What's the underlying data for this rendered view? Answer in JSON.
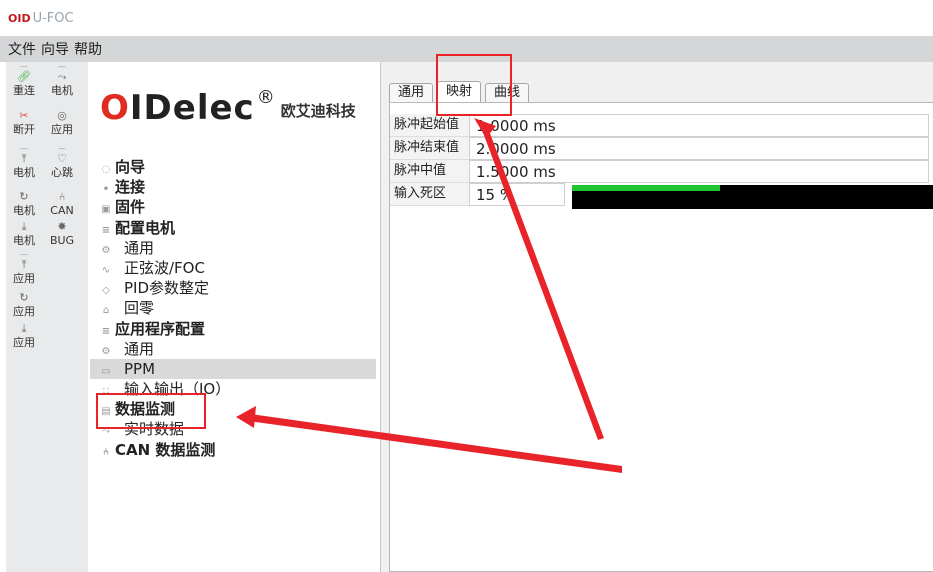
{
  "app": {
    "logo": "OID",
    "title": "U-FOC"
  },
  "menu": [
    "文件",
    "向导",
    "帮助"
  ],
  "toolbar": {
    "buttons": [
      {
        "label": "重连",
        "icon": "link-icon"
      },
      {
        "label": "电机",
        "icon": "motor-icon"
      },
      {
        "label": "断开",
        "icon": "unlink-icon"
      },
      {
        "label": "应用",
        "icon": "app-icon"
      },
      {
        "label": "电机",
        "icon": "upload-icon"
      },
      {
        "label": "心跳",
        "icon": "heart-icon"
      },
      {
        "label": "电机",
        "icon": "refresh-icon"
      },
      {
        "label": "CAN",
        "icon": "can-icon"
      },
      {
        "label": "电机",
        "icon": "download-icon"
      },
      {
        "label": "BUG",
        "icon": "bug-icon"
      },
      {
        "label": "应用",
        "icon": "upload-icon"
      },
      {
        "label": "应用",
        "icon": "refresh-icon"
      },
      {
        "label": "应用",
        "icon": "download-icon"
      }
    ]
  },
  "brand": {
    "logo_text": "OIDelec",
    "reg": "®",
    "cn": "欧艾迪科技"
  },
  "nav": [
    {
      "label": "向导",
      "bold": true
    },
    {
      "label": "连接",
      "bold": true
    },
    {
      "label": "固件",
      "bold": true
    },
    {
      "label": "配置电机",
      "bold": true
    },
    {
      "label": "通用",
      "bold": false
    },
    {
      "label": "正弦波/FOC",
      "bold": false
    },
    {
      "label": "PID参数整定",
      "bold": false
    },
    {
      "label": "回零",
      "bold": false
    },
    {
      "label": "应用程序配置",
      "bold": true
    },
    {
      "label": "通用",
      "bold": false
    },
    {
      "label": "PPM",
      "bold": false,
      "selected": true
    },
    {
      "label": "输入输出（IO）",
      "bold": false
    },
    {
      "label": "数据监测",
      "bold": true
    },
    {
      "label": "实时数据",
      "bold": false
    },
    {
      "label": "CAN 数据监测",
      "bold": true
    }
  ],
  "tabs": [
    {
      "label": "通用",
      "active": false
    },
    {
      "label": "映射",
      "active": true
    },
    {
      "label": "曲线",
      "active": false
    }
  ],
  "fields": [
    {
      "label": "脉冲起始值",
      "value": "1.0000 ms"
    },
    {
      "label": "脉冲结束值",
      "value": "2.0000 ms"
    },
    {
      "label": "脉冲中值",
      "value": "1.5000 ms"
    },
    {
      "label": "输入死区",
      "value": "15 %"
    }
  ],
  "input_level": 0.41,
  "colors": {
    "accent_red": "#e8242a",
    "bar_fill": "#22c432",
    "logo_red": "#e02b20"
  }
}
